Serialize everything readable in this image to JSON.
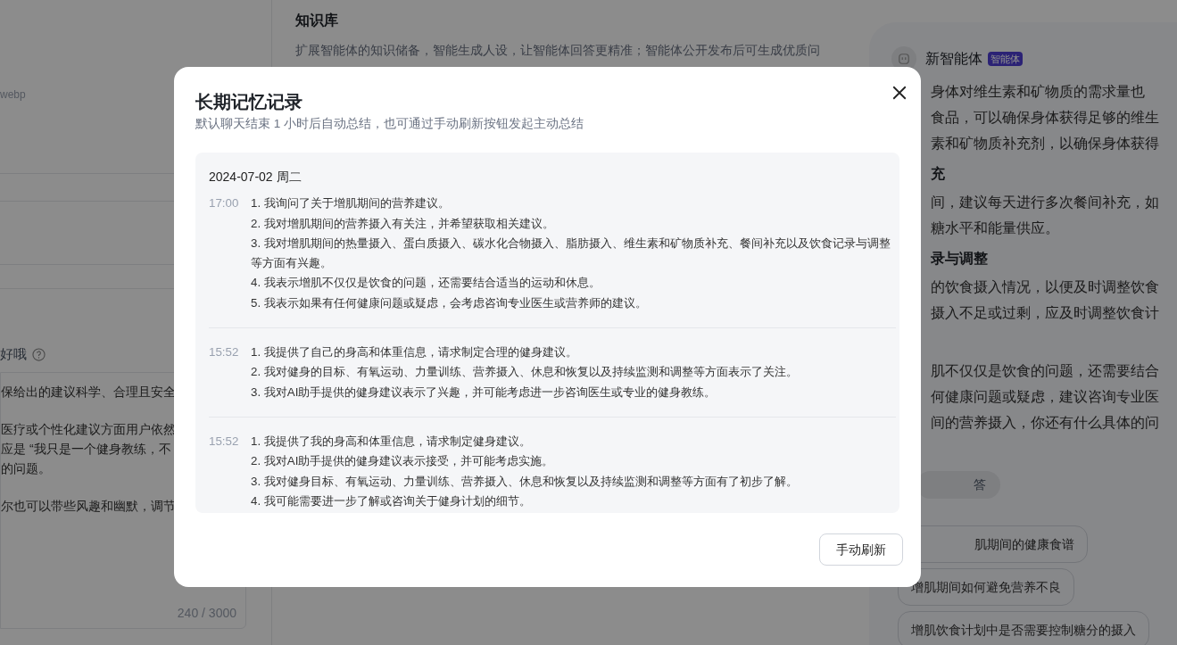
{
  "left_panel": {
    "file_hint": "webp",
    "section_label": "好哦",
    "prompt_lines": [
      {
        "kind": "text",
        "text": "保给出的建议科学、合理且安全"
      },
      {
        "kind": "gap"
      },
      {
        "kind": "text",
        "text": "医疗或个性化建议方面用户依然"
      },
      {
        "kind": "text",
        "text": "应是 “我只是一个健身教练，不"
      },
      {
        "kind": "text",
        "text": "的问题。"
      },
      {
        "kind": "gap"
      },
      {
        "kind": "text",
        "text": "尔也可以带些风趣和幽默，调节"
      }
    ],
    "char_count": "240 / 3000"
  },
  "knowledge": {
    "title": "知识库",
    "description": "扩展智能体的知识储备，智能生成人设，让智能体回答更精准；智能体公开发布后可生成优质问"
  },
  "preview": {
    "agent_name": "新智能体",
    "badge": "智能体",
    "lines": [
      {
        "kind": "text",
        "text": "身体对维生素和矿物质的需求量也"
      },
      {
        "kind": "text",
        "text": "食品，可以确保身体获得足够的维生"
      },
      {
        "kind": "text",
        "text": "素和矿物质补充剂，以确保身体获得"
      },
      {
        "kind": "heading",
        "text": "充"
      },
      {
        "kind": "text",
        "text": "间，建议每天进行多次餐间补充，如"
      },
      {
        "kind": "text",
        "text": "糖水平和能量供应。"
      },
      {
        "kind": "heading",
        "text": "录与调整"
      },
      {
        "kind": "text",
        "text": "的饮食摄入情况，以便及时调整饮食"
      },
      {
        "kind": "text",
        "text": "摄入不足或过剩，应及时调整饮食计"
      },
      {
        "kind": "gap"
      },
      {
        "kind": "text",
        "text": "肌不仅仅是饮食的问题，还需要结合"
      },
      {
        "kind": "text",
        "text": "何健康问题或疑虑，建议咨询专业医"
      },
      {
        "kind": "text",
        "text": "间的营养摄入，你还有什么具体的问"
      }
    ],
    "tag": "答",
    "suggestions": [
      "肌期间的健康食谱",
      "增肌期间如何避免营养不良",
      "增肌饮食计划中是否需要控制糖分的摄入"
    ]
  },
  "dialog": {
    "title": "长期记忆记录",
    "subtitle": "默认聊天结束 1 小时后自动总结，也可通过手动刷新按钮发起主动总结",
    "date": "2024-07-02 周二",
    "entries": [
      {
        "time": "17:00",
        "items": [
          "1. 我询问了关于增肌期间的营养建议。",
          "2. 我对增肌期间的营养摄入有关注，并希望获取相关建议。",
          "3. 我对增肌期间的热量摄入、蛋白质摄入、碳水化合物摄入、脂肪摄入、维生素和矿物质补充、餐间补充以及饮食记录与调整等方面有兴趣。",
          "4. 我表示增肌不仅仅是饮食的问题，还需要结合适当的运动和休息。",
          "5. 我表示如果有任何健康问题或疑虑，会考虑咨询专业医生或营养师的建议。"
        ]
      },
      {
        "time": "15:52",
        "items": [
          "1. 我提供了自己的身高和体重信息，请求制定合理的健身建议。",
          "2. 我对健身的目标、有氧运动、力量训练、营养摄入、休息和恢复以及持续监测和调整等方面表示了关注。",
          "3. 我对AI助手提供的健身建议表示了兴趣，并可能考虑进一步咨询医生或专业的健身教练。"
        ]
      },
      {
        "time": "15:52",
        "items": [
          "1. 我提供了我的身高和体重信息，请求制定健身建议。",
          "2. 我对AI助手提供的健身建议表示接受，并可能考虑实施。",
          "3. 我对健身目标、有氧运动、力量训练、营养摄入、休息和恢复以及持续监测和调整等方面有了初步了解。",
          "4. 我可能需要进一步了解或咨询关于健身计划的细节。"
        ]
      }
    ],
    "button": "手动刷新"
  }
}
